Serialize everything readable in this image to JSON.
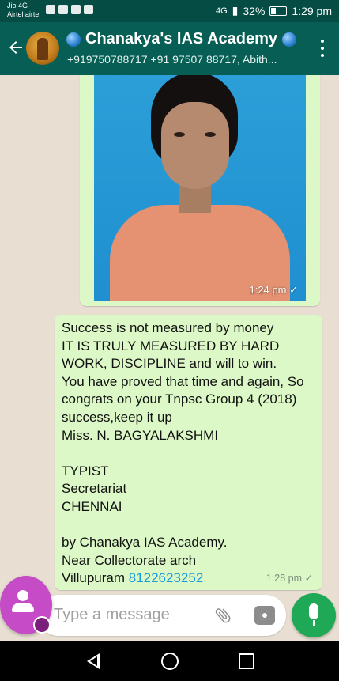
{
  "status_bar": {
    "carrier_line1": "Jio 4G",
    "carrier_line2": "Airtel|airtel",
    "network": "4G",
    "battery": "32%",
    "time": "1:29 pm"
  },
  "header": {
    "title": "Chanakya's IAS Academy",
    "subtitle": "+919750788717 +91 97507 88717, Abith..."
  },
  "messages": [
    {
      "type": "image",
      "time": "1:24 pm"
    },
    {
      "type": "text",
      "text": "Success is not measured by money\nIT IS TRULY MEASURED BY HARD WORK, DISCIPLINE and will to win.\nYou have proved that time and again, So congrats on your Tnpsc Group 4 (2018) success,keep it up\nMiss. N. BAGYALAKSHMI\n\nTYPIST\nSecretariat\nCHENNAI\n\nby Chanakya IAS Academy.\nNear Collectorate arch\nVillupuram ",
      "phone": "8122623252",
      "time": "1:28 pm"
    }
  ],
  "input": {
    "placeholder": "Type a message"
  },
  "icons": {
    "back": "arrow-left-icon",
    "menu": "more-vert-icon",
    "attach": "paperclip-icon",
    "camera": "camera-icon",
    "mic": "mic-icon",
    "contact_fab": "person-icon"
  },
  "colors": {
    "header": "#075e54",
    "status_bar": "#054c44",
    "bubble": "#dcf8c6",
    "mic_button": "#1fa855",
    "fab": "#c54cc6",
    "link": "#1b9bd8"
  }
}
